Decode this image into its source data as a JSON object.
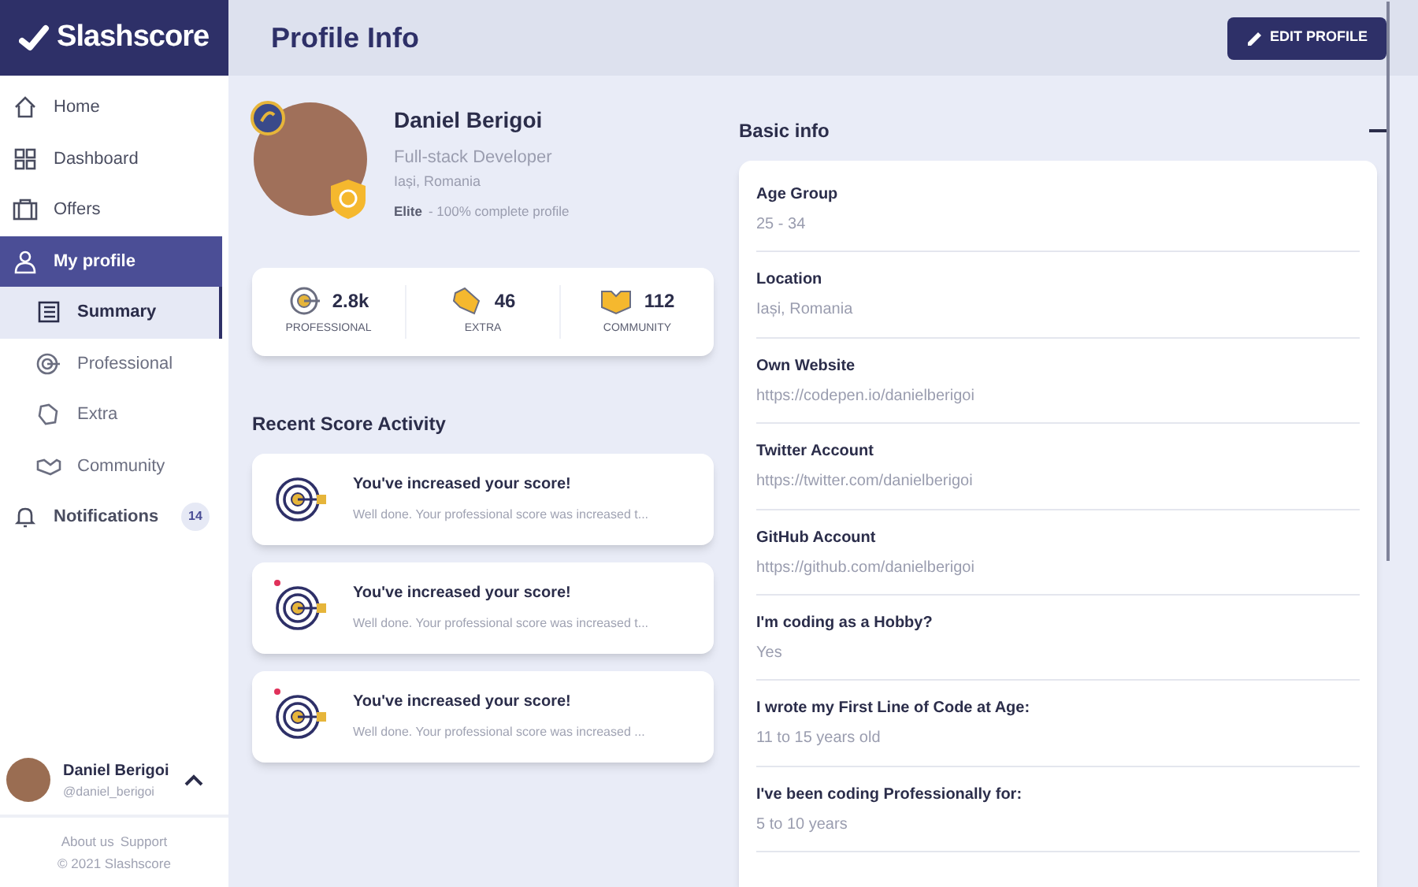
{
  "brand": {
    "name": "Slashscore"
  },
  "sidebar": {
    "items": [
      {
        "label": "Home",
        "kind": "home",
        "selected": false
      },
      {
        "label": "Dashboard",
        "kind": "dashboard",
        "selected": false
      },
      {
        "label": "Offers",
        "kind": "offers",
        "selected": false
      },
      {
        "label": "My profile",
        "kind": "profile",
        "selected": true,
        "children": [
          {
            "label": "Summary",
            "kind": "summary",
            "selected": true
          },
          {
            "label": "Professional",
            "kind": "professional",
            "selected": false
          },
          {
            "label": "Extra",
            "kind": "extra",
            "selected": false
          },
          {
            "label": "Community",
            "kind": "community",
            "selected": false
          }
        ]
      },
      {
        "label": "Notifications",
        "kind": "bell",
        "selected": false,
        "badge": "14"
      }
    ],
    "user": {
      "name": "Daniel Berigoi",
      "handle": "@daniel_berigoi"
    },
    "footer_links": [
      "About us",
      "Support"
    ],
    "copyright": "© 2021 Slashscore"
  },
  "header": {
    "title": "Profile Info",
    "button": "EDIT PROFILE"
  },
  "profile": {
    "name": "Daniel Berigoi",
    "role": "Full-stack Developer",
    "location": "Iași, Romania",
    "tier": "Elite",
    "completion": "- 100% complete profile"
  },
  "scores": [
    {
      "kind": "professional",
      "value": "2.8k",
      "label": "PROFESSIONAL"
    },
    {
      "kind": "extra",
      "value": "46",
      "label": "EXTRA"
    },
    {
      "kind": "community",
      "value": "112",
      "label": "COMMUNITY"
    }
  ],
  "activity": {
    "title": "Recent Score Activity",
    "items": [
      {
        "title": "You've increased your score!",
        "text": "Well done. Your professional score was increased t...",
        "unread": false
      },
      {
        "title": "You've increased your score!",
        "text": "Well done. Your professional score was increased t...",
        "unread": true
      },
      {
        "title": "You've increased your score!",
        "text": "Well done. Your professional score was increased ...",
        "unread": true
      }
    ]
  },
  "basic_info": {
    "title": "Basic info",
    "expanded": true,
    "fields": [
      {
        "label": "Age Group",
        "value": "25 - 34"
      },
      {
        "label": "Location",
        "value": "Iași, Romania"
      },
      {
        "label": "Own Website",
        "value": "https://codepen.io/danielberigoi"
      },
      {
        "label": "Twitter Account",
        "value": "https://twitter.com/danielberigoi"
      },
      {
        "label": "GitHub Account",
        "value": "https://github.com/danielberigoi"
      },
      {
        "label": "I'm coding as a Hobby?",
        "value": "Yes"
      },
      {
        "label": "I wrote my First Line of Code at Age:",
        "value": "11 to 15 years old"
      },
      {
        "label": "I've been coding Professionally for:",
        "value": "5 to 10 years"
      }
    ]
  }
}
